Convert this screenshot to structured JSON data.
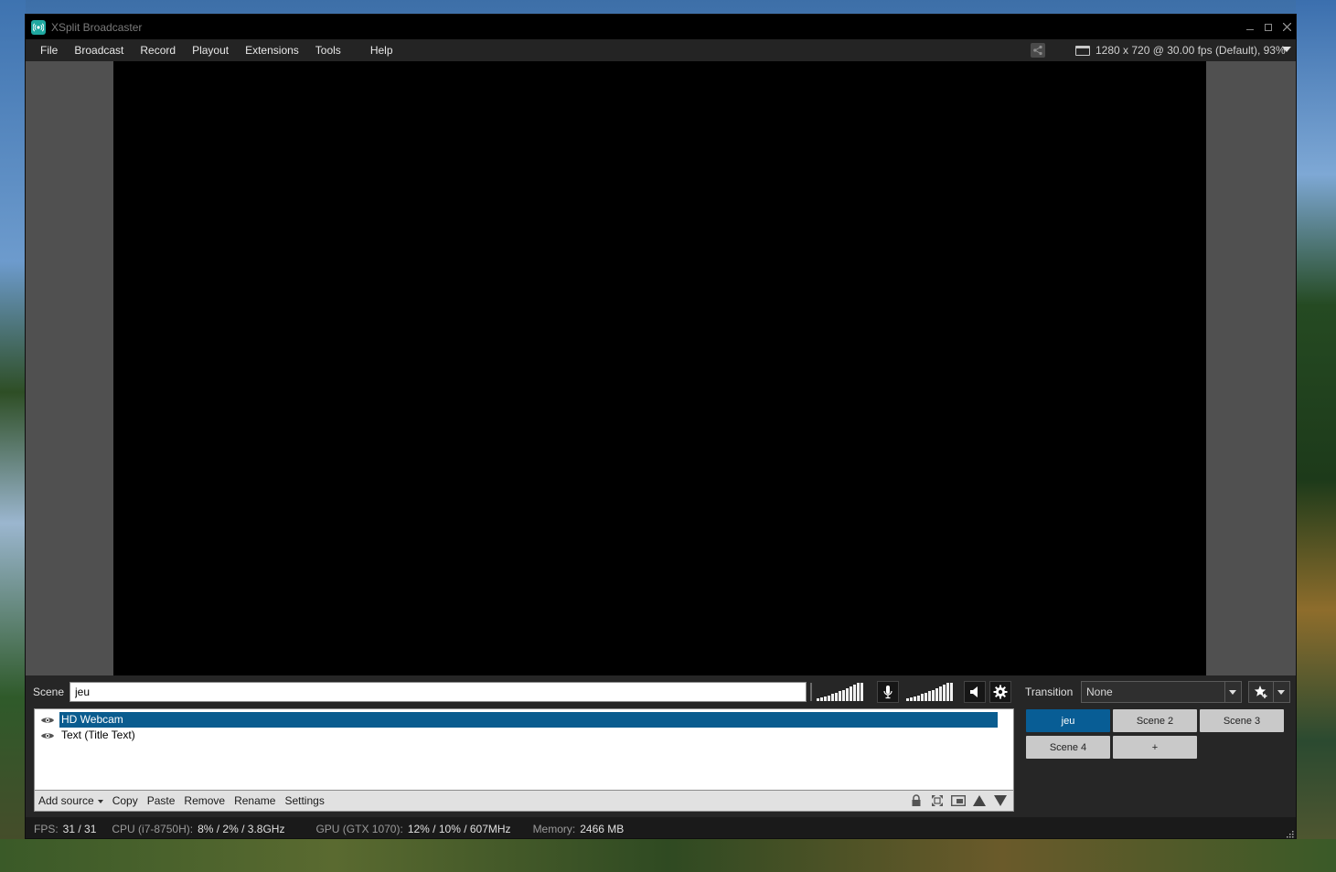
{
  "window": {
    "title": "XSplit Broadcaster"
  },
  "menu": [
    "File",
    "Broadcast",
    "Record",
    "Playout",
    "Extensions",
    "Tools",
    "Help"
  ],
  "resolution": "1280 x 720 @ 30.00 fps (Default), 93%",
  "scene": {
    "label": "Scene",
    "name": "jeu"
  },
  "sources": [
    {
      "name": "HD Webcam",
      "selected": true
    },
    {
      "name": "Text (Title Text)",
      "selected": false
    }
  ],
  "source_toolbar": {
    "add_source": "Add source",
    "copy": "Copy",
    "paste": "Paste",
    "remove": "Remove",
    "rename": "Rename",
    "settings": "Settings"
  },
  "transition": {
    "label": "Transition",
    "value": "None"
  },
  "scenes": [
    "jeu",
    "Scene 2",
    "Scene 3",
    "Scene 4",
    "+"
  ],
  "active_scene": "jeu",
  "status": {
    "fps_label": "FPS:",
    "fps": "31 / 31",
    "cpu_label": "CPU (i7-8750H):",
    "cpu": "8% / 2% / 3.8GHz",
    "gpu_label": "GPU (GTX 1070):",
    "gpu": "12% / 10% / 607MHz",
    "mem_label": "Memory:",
    "mem": "2466 MB"
  },
  "colors": {
    "accent": "#085d95",
    "selection": "#0a5c8f",
    "stage": "#000000",
    "icon": "#1fa8a0"
  },
  "icons": [
    "app-icon",
    "share-icon",
    "monitor-icon",
    "mic-icon",
    "speaker-icon",
    "gear-icon",
    "eye-icon",
    "lock-icon",
    "fit-icon",
    "frame-icon",
    "arrow-up-icon",
    "arrow-down-icon",
    "star-add-icon"
  ]
}
